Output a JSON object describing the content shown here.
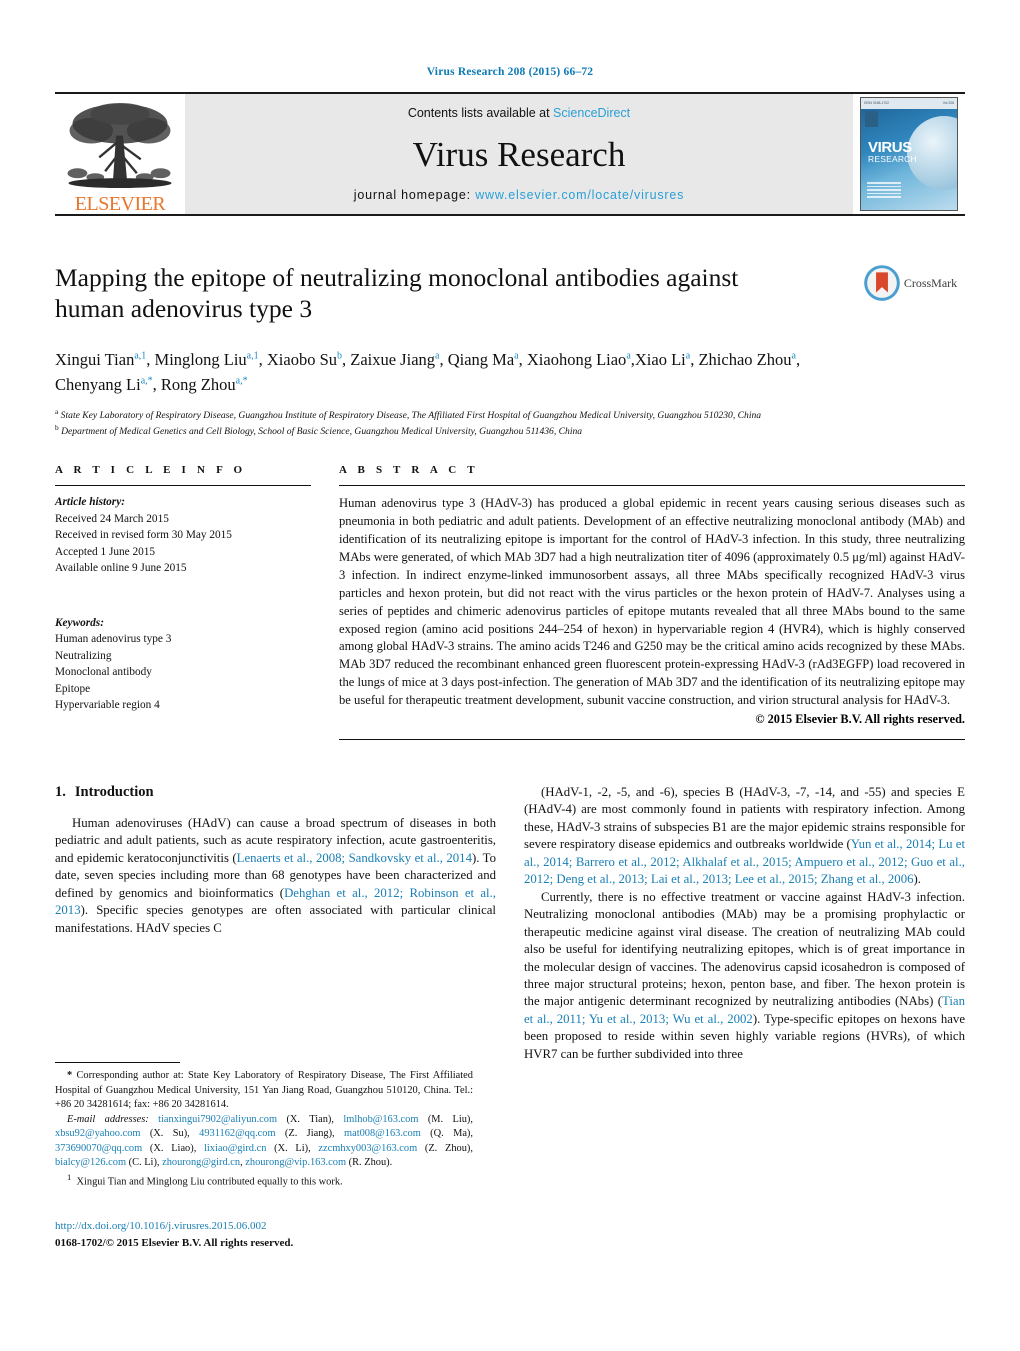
{
  "running_head": "Virus Research 208 (2015) 66–72",
  "masthead": {
    "contents_prefix": "Contents lists available at ",
    "sciencedirect": "ScienceDirect",
    "journal_title": "Virus Research",
    "homepage_prefix": "journal homepage: ",
    "homepage_url": "www.elsevier.com/locate/virusres",
    "publisher": "ELSEVIER",
    "cover_title": "VIRUS",
    "cover_subtitle": "RESEARCH",
    "accent_link": "#2a9fd6",
    "publisher_color": "#e8762c"
  },
  "article": {
    "title": "Mapping the epitope of neutralizing monoclonal antibodies against human adenovirus type 3",
    "crossmark_label": "CrossMark",
    "authors": [
      {
        "name": "Xingui Tian",
        "sup": "a,1",
        "sep": ", "
      },
      {
        "name": "Minglong Liu",
        "sup": "a,1",
        "sep": ", "
      },
      {
        "name": "Xiaobo Su",
        "sup": "b",
        "sep": ", "
      },
      {
        "name": "Zaixue Jiang",
        "sup": "a",
        "sep": ", "
      },
      {
        "name": "Qiang Ma",
        "sup": "a",
        "sep": ", "
      },
      {
        "name": "Xiaohong Liao",
        "sup": "a",
        "sep": ","
      },
      {
        "name": "Xiao Li",
        "sup": "a",
        "sep": ", "
      },
      {
        "name": "Zhichao Zhou",
        "sup": "a",
        "sep": ", "
      },
      {
        "name": "Chenyang Li",
        "sup": "a,*",
        "sep": ", "
      },
      {
        "name": "Rong Zhou",
        "sup": "a,*",
        "sep": ""
      }
    ],
    "affiliations": [
      {
        "mark": "a",
        "text": "State Key Laboratory of Respiratory Disease, Guangzhou Institute of Respiratory Disease, The Affiliated First Hospital of Guangzhou Medical University, Guangzhou 510230, China"
      },
      {
        "mark": "b",
        "text": "Department of Medical Genetics and Cell Biology, School of Basic Science, Guangzhou Medical University, Guangzhou 511436, China"
      }
    ]
  },
  "article_info": {
    "heading": "A R T I C L E    I N F O",
    "history_label": "Article history:",
    "history": [
      "Received 24 March 2015",
      "Received in revised form 30 May 2015",
      "Accepted 1 June 2015",
      "Available online 9 June 2015"
    ],
    "keywords_label": "Keywords:",
    "keywords": [
      "Human adenovirus type 3",
      "Neutralizing",
      "Monoclonal antibody",
      "Epitope",
      "Hypervariable region 4"
    ]
  },
  "abstract": {
    "heading": "A B S T R A C T",
    "text": "Human adenovirus type 3 (HAdV-3) has produced a global epidemic in recent years causing serious diseases such as pneumonia in both pediatric and adult patients. Development of an effective neutralizing monoclonal antibody (MAb) and identification of its neutralizing epitope is important for the control of HAdV-3 infection. In this study, three neutralizing MAbs were generated, of which MAb 3D7 had a high neutralization titer of 4096 (approximately 0.5 μg/ml) against HAdV-3 infection. In indirect enzyme-linked immunosorbent assays, all three MAbs specifically recognized HAdV-3 virus particles and hexon protein, but did not react with the virus particles or the hexon protein of HAdV-7. Analyses using a series of peptides and chimeric adenovirus particles of epitope mutants revealed that all three MAbs bound to the same exposed region (amino acid positions 244–254 of hexon) in hypervariable region 4 (HVR4), which is highly conserved among global HAdV-3 strains. The amino acids T246 and G250 may be the critical amino acids recognized by these MAbs. MAb 3D7 reduced the recombinant enhanced green fluorescent protein-expressing HAdV-3 (rAd3EGFP) load recovered in the lungs of mice at 3 days post-infection. The generation of MAb 3D7 and the identification of its neutralizing epitope may be useful for therapeutic treatment development, subunit vaccine construction, and virion structural analysis for HAdV-3.",
    "copyright": "© 2015 Elsevier B.V. All rights reserved."
  },
  "introduction": {
    "number": "1.",
    "heading": "Introduction",
    "left_paragraph_html": "Human adenoviruses (HAdV) can cause a broad spectrum of diseases in both pediatric and adult patients, such as acute respiratory infection, acute gastroenteritis, and epidemic keratoconjunctivitis (<span class=\"cite\">Lenaerts et al., 2008; Sandkovsky et al., 2014</span>). To date, seven species including more than 68 genotypes have been characterized and defined by genomics and bioinformatics (<span class=\"cite\">Dehghan et al., 2012; Robinson et al., 2013</span>). Specific species genotypes are often associated with particular clinical manifestations. HAdV species C",
    "right_paragraph_1_html": "(HAdV-1, -2, -5, and -6), species B (HAdV-3, -7, -14, and -55) and species E (HAdV-4) are most commonly found in patients with respiratory infection. Among these, HAdV-3 strains of subspecies B1 are the major epidemic strains responsible for severe respiratory disease epidemics and outbreaks worldwide (<span class=\"cite\">Yun et al., 2014; Lu et al., 2014; Barrero et al., 2012; Alkhalaf et al., 2015; Ampuero et al., 2012; Guo et al., 2012; Deng et al., 2013; Lai et al., 2013; Lee et al., 2015; Zhang et al., 2006</span>).",
    "right_paragraph_2_html": "Currently, there is no effective treatment or vaccine against HAdV-3 infection. Neutralizing monoclonal antibodies (MAb) may be a promising prophylactic or therapeutic medicine against viral disease. The creation of neutralizing MAb could also be useful for identifying neutralizing epitopes, which is of great importance in the molecular design of vaccines. The adenovirus capsid icosahedron is composed of three major structural proteins; hexon, penton base, and fiber. The hexon protein is the major antigenic determinant recognized by neutralizing antibodies (NAbs) (<span class=\"cite\">Tian et al., 2011; Yu et al., 2013; Wu et al., 2002</span>). Type-specific epitopes on hexons have been proposed to reside within seven highly variable regions (HVRs), of which HVR7 can be further subdivided into three"
  },
  "footnotes": {
    "corresponding_html": "<span style=\"font-weight:bold\">*</span> Corresponding author at: State Key Laboratory of Respiratory Disease, The First Affiliated Hospital of Guangzhou Medical University, 151 Yan Jiang Road, Guangzhou 510120, China. Tel.: +86 20 34281614; fax: +86 20 34281614.",
    "emails_html": "<span class=\"ital\">E-mail addresses:</span> <span class=\"cite\">tianxingui7902@aliyun.com</span> (X. Tian), <span class=\"cite\">lmlhob@163.com</span> (M. Liu), <span class=\"cite\">xbsu92@yahoo.com</span> (X. Su), <span class=\"cite\">4931162@qq.com</span> (Z. Jiang), <span class=\"cite\">mat008@163.com</span> (Q. Ma), <span class=\"cite\">373690070@qq.com</span> (X. Liao), <span class=\"cite\">lixiao@gird.cn</span> (X. Li), <span class=\"cite\">zzcmhxy003@163.com</span> (Z. Zhou), <span class=\"cite\">bialcy@126.com</span> (C. Li), <span class=\"cite\">zhourong@gird.cn</span>, <span class=\"cite\">zhourong@vip.163.com</span> (R. Zhou).",
    "equal_contribution_html": "<sup>1</sup>&nbsp; Xingui Tian and Minglong Liu contributed equally to this work."
  },
  "doi_block": {
    "doi_url": "http://dx.doi.org/10.1016/j.virusres.2015.06.002",
    "issn_line": "0168-1702/© 2015 Elsevier B.V. All rights reserved."
  }
}
